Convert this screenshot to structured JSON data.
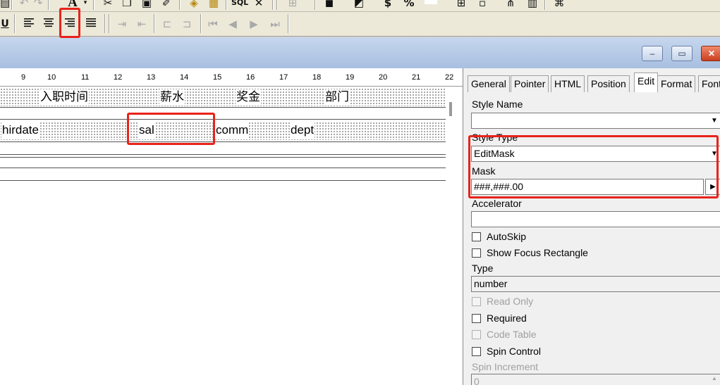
{
  "toolbar_top": {
    "icons": [
      "stamp-icon",
      "undo-icon",
      "redo-icon",
      "font-color-icon",
      "cut-icon",
      "copy-icon",
      "paste-icon",
      "eraser-icon",
      "bring-front-icon",
      "tag-icon",
      "sql-icon",
      "delete-icon",
      "frame-icon",
      "fill-color-icon",
      "border-icon",
      "currency-icon",
      "percent-icon",
      "blank-icon",
      "add-column-icon",
      "tab-order-icon",
      "align-grid-icon",
      "tree-icon"
    ],
    "labels": {
      "font": "A",
      "currency": "$",
      "percent": "%",
      "sql": "SQL",
      "delete": "✕"
    }
  },
  "toolbar_format": {
    "underline": "U",
    "align_buttons": [
      "align-left-icon",
      "align-center-icon",
      "align-right-icon",
      "justify-icon"
    ],
    "highlighted_button": "align-right-icon"
  },
  "window_controls": {
    "minimize": "–",
    "restore": "▭",
    "close": "✕"
  },
  "ruler": {
    "marks": [
      "9",
      "10",
      "11",
      "12",
      "13",
      "14",
      "15",
      "16",
      "17",
      "18",
      "19",
      "20",
      "21",
      "22"
    ]
  },
  "header_band": {
    "cells": [
      "入职时间",
      "薪水",
      "奖金",
      "部门"
    ]
  },
  "detail_band": {
    "cells": [
      "hirdate",
      "sal",
      "comm",
      "dept"
    ],
    "highlighted_cell": "sal"
  },
  "panel": {
    "tabs": [
      "General",
      "Pointer",
      "HTML",
      "Position",
      "Edit",
      "Format",
      "Font"
    ],
    "active_tab": "Edit",
    "style_name_label": "Style Name",
    "style_name_value": "",
    "style_type_label": "Style Type",
    "style_type_value": "EditMask",
    "mask_label": "Mask",
    "mask_value": "###,###.00",
    "accelerator_label": "Accelerator",
    "accelerator_value": "",
    "checkboxes_a": [
      {
        "label": "AutoSkip",
        "enabled": true,
        "checked": false
      },
      {
        "label": "Show Focus Rectangle",
        "enabled": true,
        "checked": false
      }
    ],
    "type_label": "Type",
    "type_value": "number",
    "checkboxes_b": [
      {
        "label": "Read Only",
        "enabled": false,
        "checked": false
      },
      {
        "label": "Required",
        "enabled": true,
        "checked": false
      },
      {
        "label": "Code Table",
        "enabled": false,
        "checked": false
      },
      {
        "label": "Spin Control",
        "enabled": true,
        "checked": false
      }
    ],
    "spin_increment_label": "Spin Increment",
    "spin_increment_value": "0"
  },
  "colors": {
    "highlight": "#e8231a",
    "titlebar": "#b4c8e6",
    "panel": "#f0f0f0",
    "toolbar": "#ece9d8"
  }
}
